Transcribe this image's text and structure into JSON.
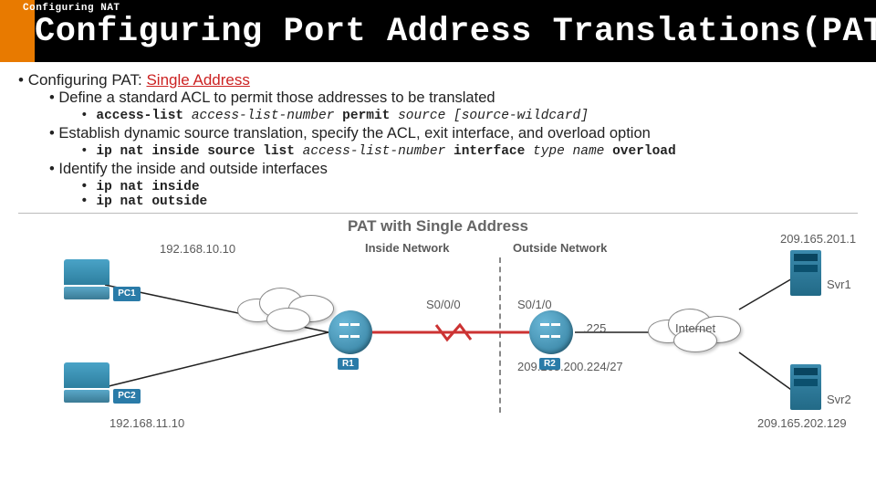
{
  "header": {
    "breadcrumb": "Configuring NAT",
    "title": "Configuring Port Address Translations(PAT)(Cont.)"
  },
  "bullets": {
    "l1": "Configuring PAT: ",
    "l1_red": "Single Address",
    "l2a": "Define a standard ACL to permit those addresses to be translated",
    "l3a_b1": "access-list",
    "l3a_i1": "access-list-number",
    "l3a_b2": "permit",
    "l3a_i2": "source",
    "l3a_i3": "[source-wildcard]",
    "l2b": "Establish dynamic source translation, specify the ACL, exit interface, and overload option",
    "l3b_b1": "ip nat inside source list",
    "l3b_i1": "access-list-number",
    "l3b_b2": "interface",
    "l3b_i2": "type",
    "l3b_i3": "name",
    "l3b_b3": "overload",
    "l2c": "Identify the inside and outside interfaces",
    "l3c_1": "ip nat inside",
    "l3c_2": "ip nat outside"
  },
  "diagram": {
    "title": "PAT with Single Address",
    "inside": "Inside Network",
    "outside": "Outside Network",
    "pc1_ip": "192.168.10.10",
    "pc2_ip": "192.168.11.10",
    "pc1": "PC1",
    "pc2": "PC2",
    "r1": "R1",
    "r2": "R2",
    "s000": "S0/0/0",
    "s010": "S0/1/0",
    "dot225": ".225",
    "subnet": "209.165.200.224/27",
    "internet": "Internet",
    "svr1": "Svr1",
    "svr2": "Svr2",
    "svr1_ip": "209.165.201.1",
    "svr2_ip": "209.165.202.129"
  }
}
